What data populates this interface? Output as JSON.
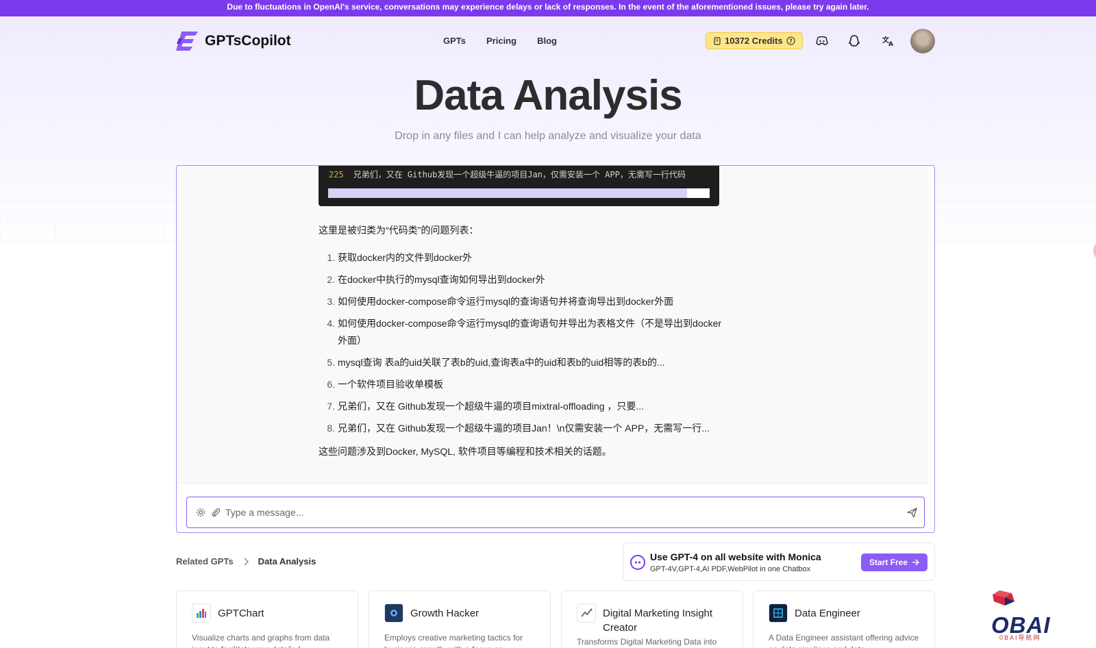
{
  "banner": "Due to fluctuations in OpenAI's service, conversations may experience delays or lack of responses. In the event of the aforementioned issues, please try again later.",
  "header": {
    "logo": "GPTsCopilot",
    "nav": [
      "GPTs",
      "Pricing",
      "Blog"
    ],
    "credits": "10372 Credits"
  },
  "hero": {
    "title": "Data Analysis",
    "subtitle": "Drop in any files and I can help analyze and visualize your data"
  },
  "chat": {
    "code": {
      "line_number": "225",
      "line_text": "兄弟们，又在 Github发现一个超级牛逼的项目Jan，仅需安装一个 APP，无需写一行代码"
    },
    "intro": "这里是被归类为“代码类”的问题列表：",
    "items": [
      "获取docker内的文件到docker外",
      "在docker中执行的mysql查询如何导出到docker外",
      "如何使用docker-compose命令运行mysql的查询语句并将查询导出到docker外面",
      "如何使用docker-compose命令运行mysql的查询语句并导出为表格文件（不是导出到docker外面）",
      "mysql查询 表a的uid关联了表b的uid,查询表a中的uid和表b的uid相等的表b的...",
      "一个软件项目验收单模板",
      "兄弟们，又在 Github发现一个超级牛逼的项目mixtral-offloading ，只要...",
      "兄弟们，又在 Github发现一个超级牛逼的项目Jan！\\n仅需安装一个 APP，无需写一行..."
    ],
    "outro": "这些问题涉及到Docker, MySQL, 软件项目等编程和技术相关的话题。",
    "input_placeholder": "Type a message..."
  },
  "breadcrumb": {
    "root": "Related GPTs",
    "current": "Data Analysis"
  },
  "promo": {
    "title": "Use GPT-4 on all website with Monica",
    "subtitle": "GPT-4V,GPT-4,AI PDF,WebPilot in one Chatbox",
    "button": "Start Free"
  },
  "cards": [
    {
      "title": "GPTChart",
      "desc": "Visualize charts and graphs from data input to facilitate your detailed",
      "icon": "bar-chart-icon"
    },
    {
      "title": "Growth Hacker",
      "desc": "Employs creative marketing tactics for business growth, with a focus on",
      "icon": "growth-hacker-icon"
    },
    {
      "title": "Digital Marketing Insight Creator",
      "desc": "Transforms Digital Marketing Data into",
      "icon": "marketing-icon"
    },
    {
      "title": "Data Engineer",
      "desc": "A Data Engineer assistant offering advice on data pipelines and data",
      "icon": "data-engineer-icon"
    }
  ],
  "watermark": {
    "text": "OBAI",
    "sub": "0BAI导航网"
  },
  "colors": {
    "accent": "#7c3aed",
    "button": "#8b5cf6",
    "credits_bg": "#fde68a"
  }
}
